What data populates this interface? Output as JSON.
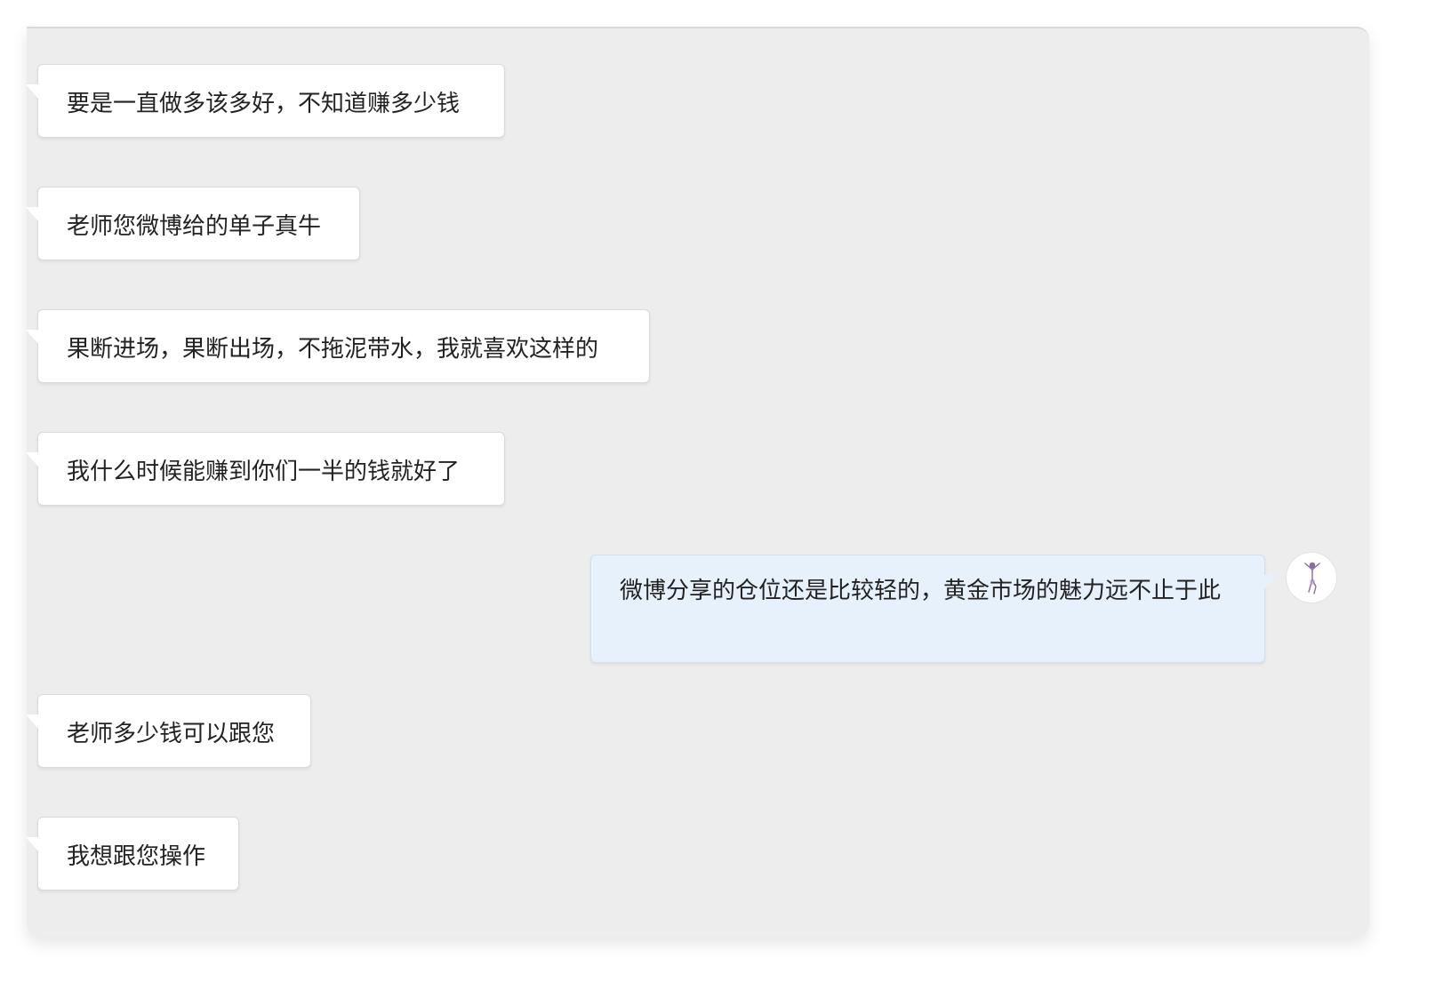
{
  "messages": [
    {
      "direction": "incoming",
      "text": "要是一直做多该多好，不知道赚多少钱"
    },
    {
      "direction": "incoming",
      "text": "老师您微博给的单子真牛"
    },
    {
      "direction": "incoming",
      "text": "果断进场，果断出场，不拖泥带水，我就喜欢这样的"
    },
    {
      "direction": "incoming",
      "text": "我什么时候能赚到你们一半的钱就好了"
    },
    {
      "direction": "outgoing",
      "text": "微博分享的仓位还是比较轻的，黄金市场的魅力远不止于此"
    },
    {
      "direction": "incoming",
      "text": "老师多少钱可以跟您"
    },
    {
      "direction": "incoming",
      "text": "我想跟您操作"
    }
  ],
  "avatar": {
    "icon": "dancer-figure-icon"
  },
  "colors": {
    "panel_background": "#ededed",
    "incoming_bubble": "#ffffff",
    "outgoing_bubble": "#e7f1fb",
    "text": "#222222"
  }
}
